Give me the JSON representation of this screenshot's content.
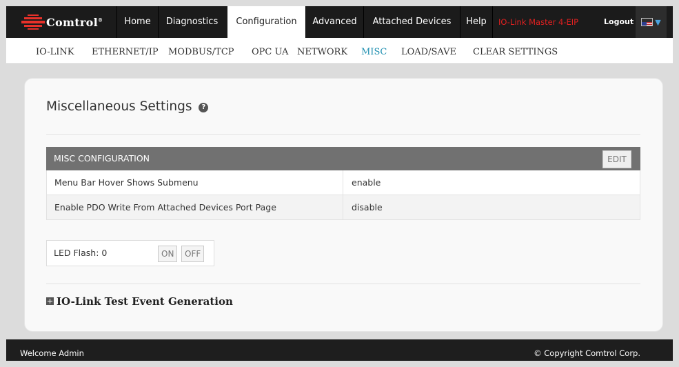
{
  "brand": {
    "name": "Comtrol",
    "mark": "®"
  },
  "nav": {
    "home": "Home",
    "diagnostics": "Diagnostics",
    "configuration": "Configuration",
    "advanced": "Advanced",
    "attached_devices": "Attached Devices",
    "help": "Help",
    "device_name": "IO-Link Master 4-EIP",
    "logout": "Logout",
    "active": "Configuration"
  },
  "subnav": {
    "io_link": "IO-LINK",
    "ethernet_ip": "ETHERNET/IP",
    "modbus_tcp": "MODBUS/TCP",
    "opc_ua": "OPC UA",
    "network": "NETWORK",
    "misc": "MISC",
    "load_save": "LOAD/SAVE",
    "clear_settings": "CLEAR SETTINGS",
    "active": "MISC"
  },
  "main": {
    "title": "Miscellaneous Settings",
    "table": {
      "header": "MISC CONFIGURATION",
      "edit_label": "EDIT",
      "rows": [
        {
          "label": "Menu Bar Hover Shows Submenu",
          "value": "enable"
        },
        {
          "label": "Enable PDO Write From Attached Devices Port Page",
          "value": "disable"
        }
      ]
    },
    "led": {
      "label": "LED Flash: 0",
      "on": "ON",
      "off": "OFF"
    },
    "section": "IO-Link Test Event Generation"
  },
  "footer": {
    "welcome": "Welcome Admin",
    "copyright": "© Copyright Comtrol Corp."
  },
  "colors": {
    "topbar": "#1b1b1b",
    "active_tab": "#ffffff",
    "device_name": "#e02020",
    "subnav_active": "#1f8fb0",
    "table_header": "#717171",
    "logo_red": "#e8312a"
  },
  "icons": [
    "comtrol-logo-icon",
    "help-icon",
    "us-flag-icon",
    "chevron-down-icon",
    "expand-plus-icon"
  ]
}
